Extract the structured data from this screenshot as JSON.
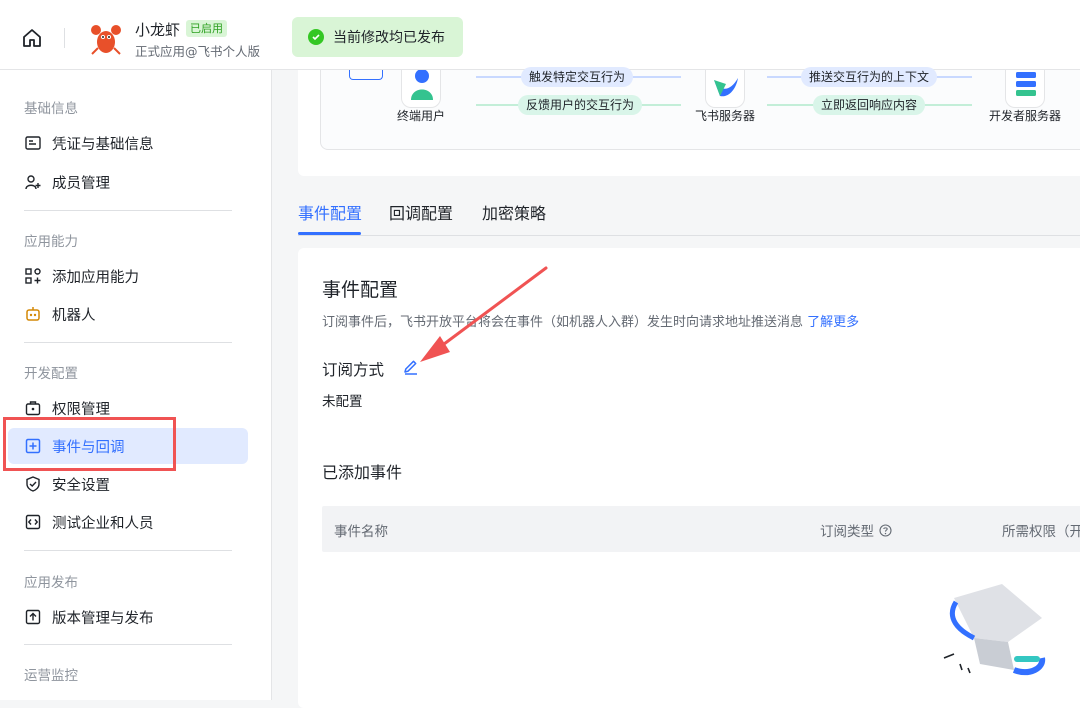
{
  "header": {
    "app_name": "小龙虾",
    "status_badge": "已启用",
    "app_subtitle": "正式应用@飞书个人版",
    "toast_message": "当前修改均已发布"
  },
  "sidebar": {
    "groups": [
      {
        "title": "基础信息",
        "items": [
          {
            "label": "凭证与基础信息",
            "icon": "id-card-icon"
          },
          {
            "label": "成员管理",
            "icon": "add-user-icon"
          }
        ]
      },
      {
        "title": "应用能力",
        "items": [
          {
            "label": "添加应用能力",
            "icon": "grid-plus-icon"
          },
          {
            "label": "机器人",
            "icon": "robot-icon"
          }
        ]
      },
      {
        "title": "开发配置",
        "items": [
          {
            "label": "权限管理",
            "icon": "lock-box-icon"
          },
          {
            "label": "事件与回调",
            "icon": "event-plus-icon",
            "active": true
          },
          {
            "label": "安全设置",
            "icon": "shield-check-icon"
          },
          {
            "label": "测试企业和人员",
            "icon": "code-box-icon"
          }
        ]
      },
      {
        "title": "应用发布",
        "items": [
          {
            "label": "版本管理与发布",
            "icon": "upload-box-icon"
          }
        ]
      },
      {
        "title": "运营监控",
        "items": []
      }
    ]
  },
  "flow": {
    "nodes": [
      "终端用户",
      "飞书服务器",
      "开发者服务器"
    ],
    "arrows": {
      "trigger": "触发特定交互行为",
      "feedback": "反馈用户的交互行为",
      "push": "推送交互行为的上下文",
      "respond": "立即返回响应内容"
    },
    "colors": {
      "forward": "#3370ff",
      "back": "#34c38f"
    }
  },
  "tabs": [
    {
      "label": "事件配置",
      "active": true
    },
    {
      "label": "回调配置",
      "active": false
    },
    {
      "label": "加密策略",
      "active": false
    }
  ],
  "event_config": {
    "title": "事件配置",
    "description": "订阅事件后，飞书开放平台将会在事件（如机器人入群）发生时向请求地址推送消息",
    "learn_more": "了解更多",
    "subscribe_label": "订阅方式",
    "subscribe_value": "未配置",
    "added_events_title": "已添加事件",
    "table_headers": [
      "事件名称",
      "订阅类型",
      "所需权限（开"
    ]
  },
  "colors": {
    "accent": "#3370ff",
    "annotation_red": "#f05353",
    "success": "#34c724"
  }
}
